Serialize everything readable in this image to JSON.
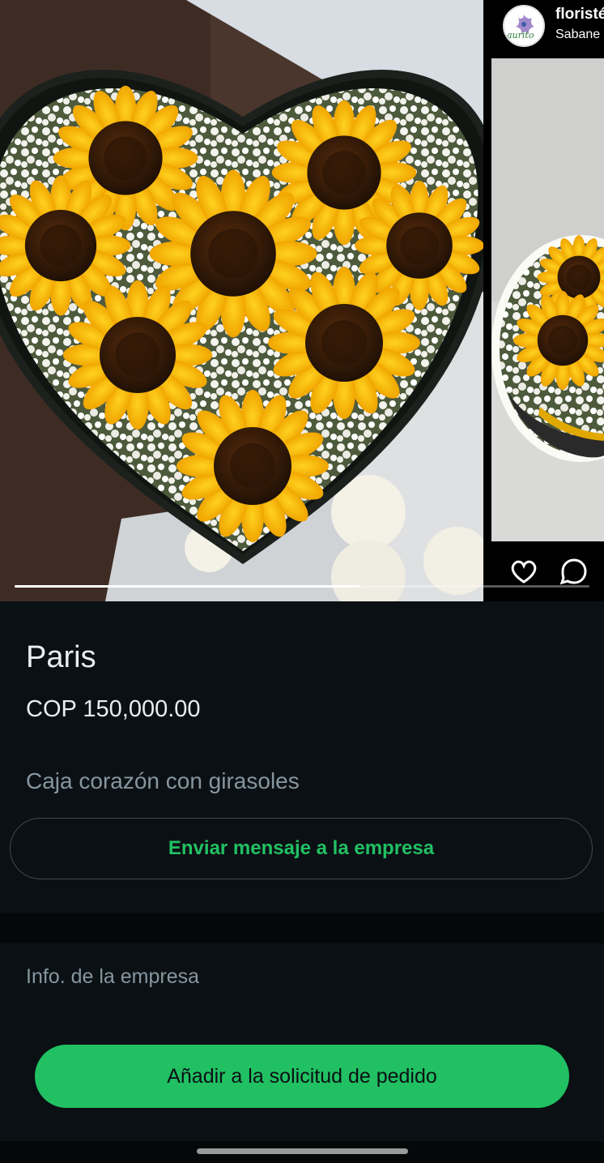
{
  "carousel": {
    "progress": 0.6,
    "next_slide": {
      "account_name": "floristé",
      "account_location": "Sabane",
      "avatar_text": "aurito",
      "actions": [
        "heart-icon",
        "comment-icon"
      ]
    }
  },
  "product": {
    "title": "Paris",
    "price": "COP 150,000.00",
    "description": "Caja corazón con girasoles"
  },
  "buttons": {
    "message_business": "Enviar mensaje a la empresa",
    "add_to_order": "Añadir a la solicitud de pedido"
  },
  "business_info": {
    "label": "Info. de la empresa"
  },
  "colors": {
    "background": "#0b1014",
    "accent_green": "#21c063",
    "text_primary": "#e9edef",
    "text_secondary": "#8696a0"
  }
}
